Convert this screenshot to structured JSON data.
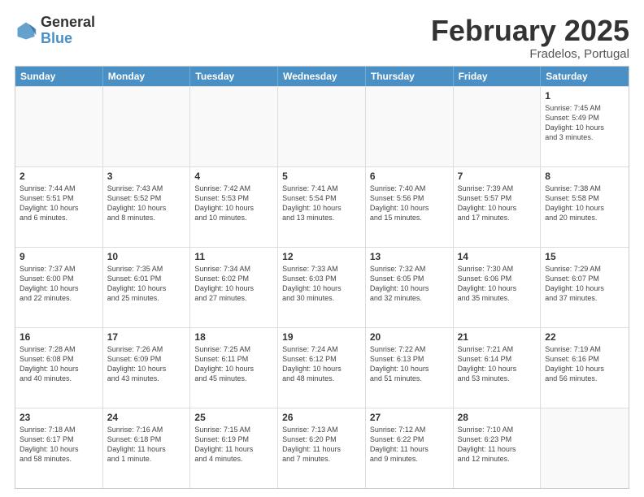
{
  "header": {
    "logo_general": "General",
    "logo_blue": "Blue",
    "month_title": "February 2025",
    "location": "Fradelos, Portugal"
  },
  "weekdays": [
    "Sunday",
    "Monday",
    "Tuesday",
    "Wednesday",
    "Thursday",
    "Friday",
    "Saturday"
  ],
  "rows": [
    [
      {
        "day": "",
        "info": ""
      },
      {
        "day": "",
        "info": ""
      },
      {
        "day": "",
        "info": ""
      },
      {
        "day": "",
        "info": ""
      },
      {
        "day": "",
        "info": ""
      },
      {
        "day": "",
        "info": ""
      },
      {
        "day": "1",
        "info": "Sunrise: 7:45 AM\nSunset: 5:49 PM\nDaylight: 10 hours\nand 3 minutes."
      }
    ],
    [
      {
        "day": "2",
        "info": "Sunrise: 7:44 AM\nSunset: 5:51 PM\nDaylight: 10 hours\nand 6 minutes."
      },
      {
        "day": "3",
        "info": "Sunrise: 7:43 AM\nSunset: 5:52 PM\nDaylight: 10 hours\nand 8 minutes."
      },
      {
        "day": "4",
        "info": "Sunrise: 7:42 AM\nSunset: 5:53 PM\nDaylight: 10 hours\nand 10 minutes."
      },
      {
        "day": "5",
        "info": "Sunrise: 7:41 AM\nSunset: 5:54 PM\nDaylight: 10 hours\nand 13 minutes."
      },
      {
        "day": "6",
        "info": "Sunrise: 7:40 AM\nSunset: 5:56 PM\nDaylight: 10 hours\nand 15 minutes."
      },
      {
        "day": "7",
        "info": "Sunrise: 7:39 AM\nSunset: 5:57 PM\nDaylight: 10 hours\nand 17 minutes."
      },
      {
        "day": "8",
        "info": "Sunrise: 7:38 AM\nSunset: 5:58 PM\nDaylight: 10 hours\nand 20 minutes."
      }
    ],
    [
      {
        "day": "9",
        "info": "Sunrise: 7:37 AM\nSunset: 6:00 PM\nDaylight: 10 hours\nand 22 minutes."
      },
      {
        "day": "10",
        "info": "Sunrise: 7:35 AM\nSunset: 6:01 PM\nDaylight: 10 hours\nand 25 minutes."
      },
      {
        "day": "11",
        "info": "Sunrise: 7:34 AM\nSunset: 6:02 PM\nDaylight: 10 hours\nand 27 minutes."
      },
      {
        "day": "12",
        "info": "Sunrise: 7:33 AM\nSunset: 6:03 PM\nDaylight: 10 hours\nand 30 minutes."
      },
      {
        "day": "13",
        "info": "Sunrise: 7:32 AM\nSunset: 6:05 PM\nDaylight: 10 hours\nand 32 minutes."
      },
      {
        "day": "14",
        "info": "Sunrise: 7:30 AM\nSunset: 6:06 PM\nDaylight: 10 hours\nand 35 minutes."
      },
      {
        "day": "15",
        "info": "Sunrise: 7:29 AM\nSunset: 6:07 PM\nDaylight: 10 hours\nand 37 minutes."
      }
    ],
    [
      {
        "day": "16",
        "info": "Sunrise: 7:28 AM\nSunset: 6:08 PM\nDaylight: 10 hours\nand 40 minutes."
      },
      {
        "day": "17",
        "info": "Sunrise: 7:26 AM\nSunset: 6:09 PM\nDaylight: 10 hours\nand 43 minutes."
      },
      {
        "day": "18",
        "info": "Sunrise: 7:25 AM\nSunset: 6:11 PM\nDaylight: 10 hours\nand 45 minutes."
      },
      {
        "day": "19",
        "info": "Sunrise: 7:24 AM\nSunset: 6:12 PM\nDaylight: 10 hours\nand 48 minutes."
      },
      {
        "day": "20",
        "info": "Sunrise: 7:22 AM\nSunset: 6:13 PM\nDaylight: 10 hours\nand 51 minutes."
      },
      {
        "day": "21",
        "info": "Sunrise: 7:21 AM\nSunset: 6:14 PM\nDaylight: 10 hours\nand 53 minutes."
      },
      {
        "day": "22",
        "info": "Sunrise: 7:19 AM\nSunset: 6:16 PM\nDaylight: 10 hours\nand 56 minutes."
      }
    ],
    [
      {
        "day": "23",
        "info": "Sunrise: 7:18 AM\nSunset: 6:17 PM\nDaylight: 10 hours\nand 58 minutes."
      },
      {
        "day": "24",
        "info": "Sunrise: 7:16 AM\nSunset: 6:18 PM\nDaylight: 11 hours\nand 1 minute."
      },
      {
        "day": "25",
        "info": "Sunrise: 7:15 AM\nSunset: 6:19 PM\nDaylight: 11 hours\nand 4 minutes."
      },
      {
        "day": "26",
        "info": "Sunrise: 7:13 AM\nSunset: 6:20 PM\nDaylight: 11 hours\nand 7 minutes."
      },
      {
        "day": "27",
        "info": "Sunrise: 7:12 AM\nSunset: 6:22 PM\nDaylight: 11 hours\nand 9 minutes."
      },
      {
        "day": "28",
        "info": "Sunrise: 7:10 AM\nSunset: 6:23 PM\nDaylight: 11 hours\nand 12 minutes."
      },
      {
        "day": "",
        "info": ""
      }
    ]
  ]
}
